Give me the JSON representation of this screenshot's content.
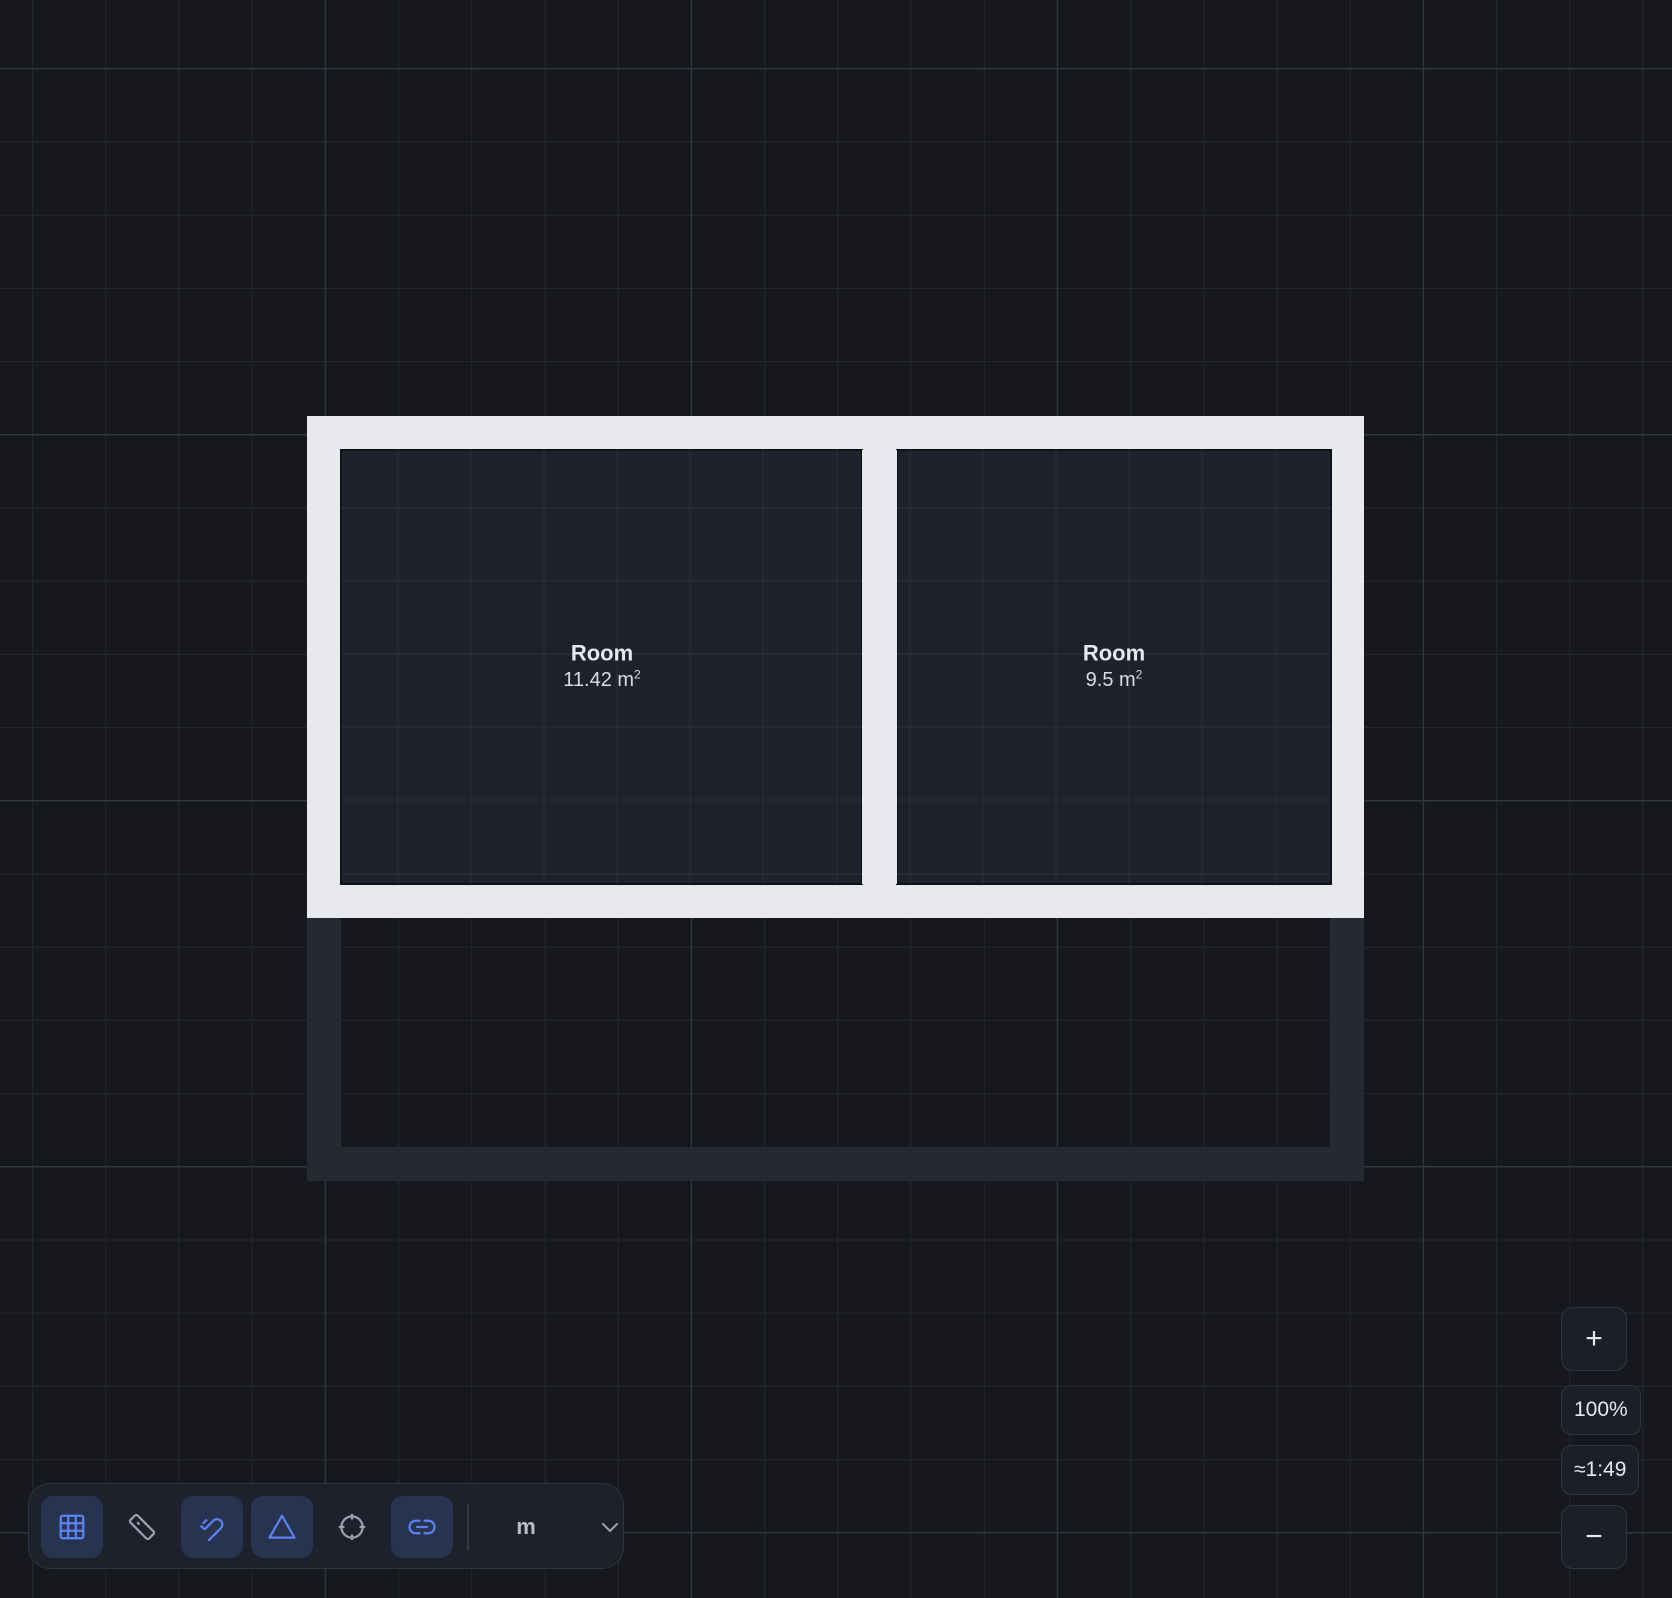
{
  "rooms": [
    {
      "name": "Room",
      "area": "11.42 m",
      "area_sup": "2"
    },
    {
      "name": "Room",
      "area": "9.5 m",
      "area_sup": "2"
    }
  ],
  "zoom": {
    "in_label": "+",
    "level": "100%",
    "scale": "≈1:49",
    "out_label": "−"
  },
  "toolbar": {
    "unit": "m",
    "tools": [
      {
        "icon": "grid-icon",
        "active": true
      },
      {
        "icon": "ruler-icon",
        "active": false
      },
      {
        "icon": "magnet-icon",
        "active": true
      },
      {
        "icon": "triangle-icon",
        "active": true
      },
      {
        "icon": "crosshair-icon",
        "active": false
      },
      {
        "icon": "link-icon",
        "active": true
      }
    ]
  },
  "colors": {
    "background": "#16181d",
    "wall": "#e8e9ed",
    "room_fill": "#1e222c",
    "accent": "#5b82f0"
  }
}
